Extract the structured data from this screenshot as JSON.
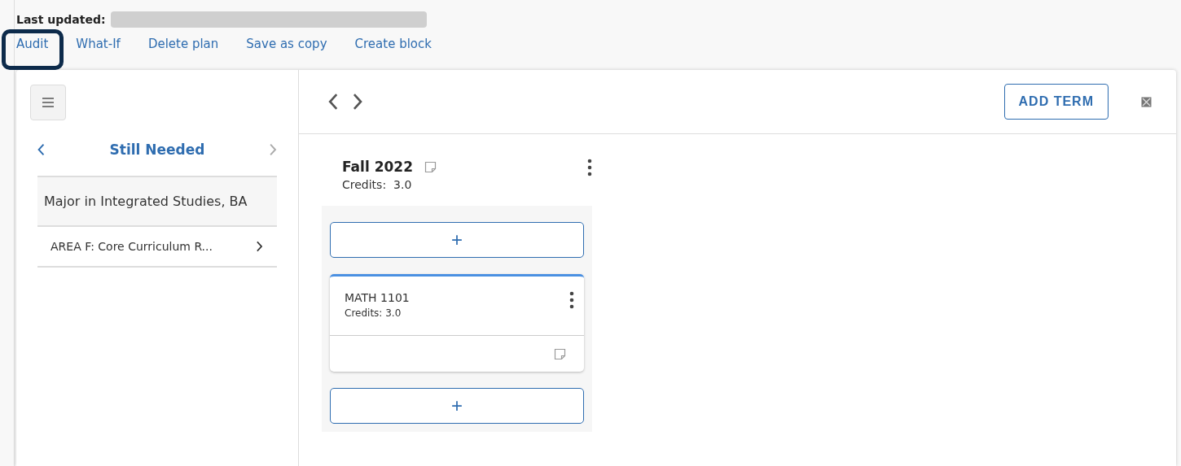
{
  "header": {
    "last_updated_label": "Last updated:",
    "redacted": true
  },
  "links": [
    {
      "label": "Audit",
      "highlighted": true
    },
    {
      "label": "What-If",
      "highlighted": false
    },
    {
      "label": "Delete plan",
      "highlighted": false
    },
    {
      "label": "Save as copy",
      "highlighted": false
    },
    {
      "label": "Create block",
      "highlighted": false
    }
  ],
  "sidebar": {
    "title": "Still Needed",
    "prev_disabled": false,
    "next_disabled": true,
    "group": "Major in Integrated Studies, BA",
    "items": [
      {
        "label": "AREA F: Core Curriculum R..."
      }
    ]
  },
  "toolbar": {
    "add_term": "ADD TERM"
  },
  "terms": [
    {
      "title": "Fall 2022",
      "credits_label": "Credits:",
      "credits": "3.0",
      "add_symbol": "+",
      "courses": [
        {
          "code": "MATH 1101",
          "credits": "Credits: 3.0"
        }
      ]
    }
  ]
}
